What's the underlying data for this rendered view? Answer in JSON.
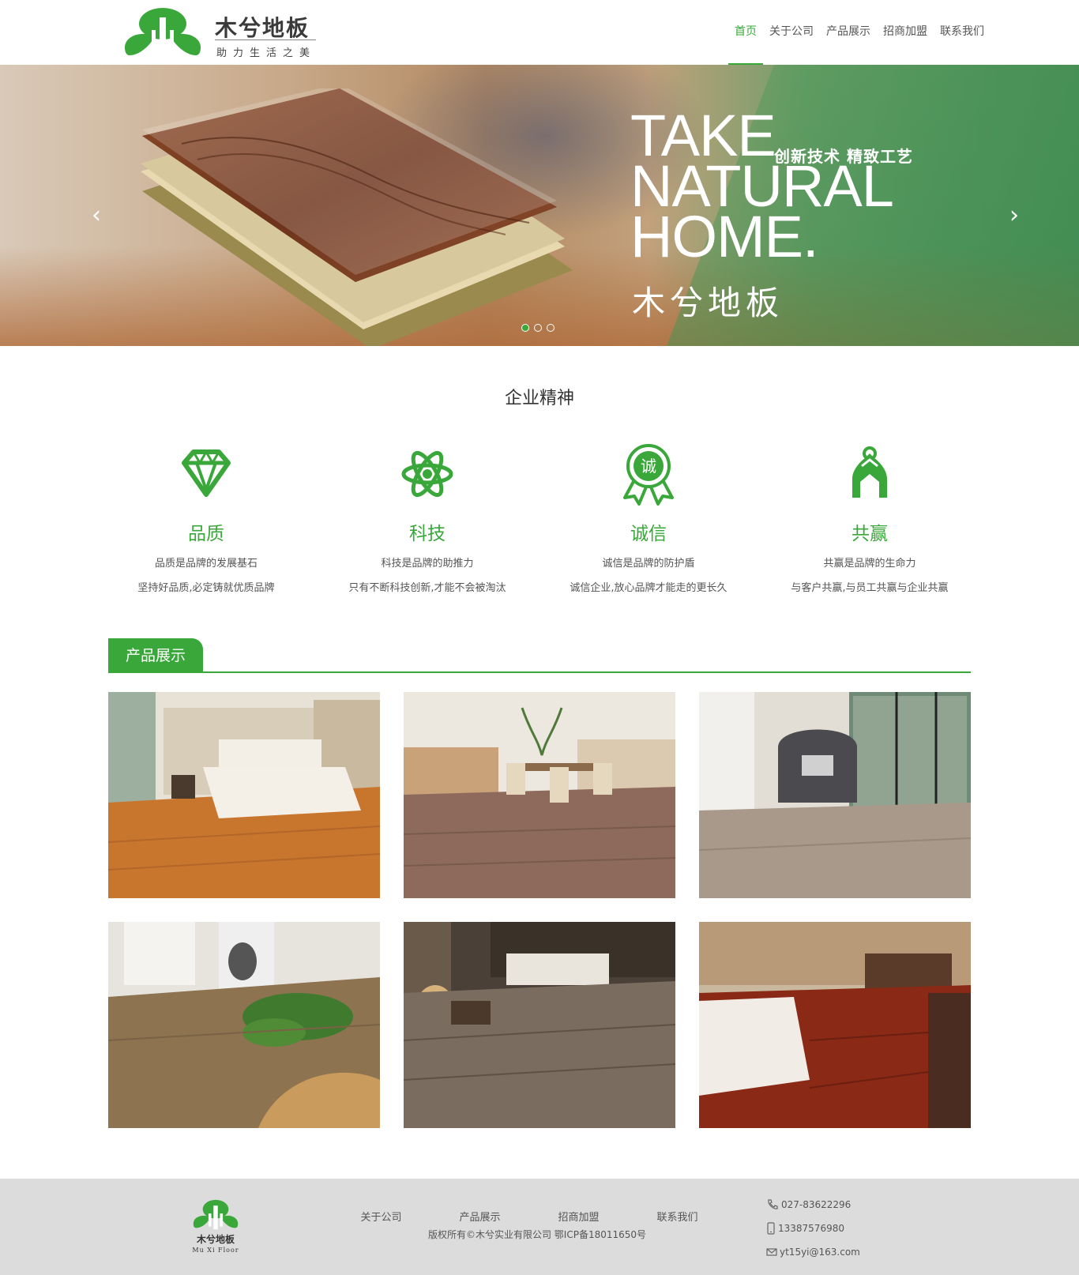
{
  "brand": {
    "name": "木兮地板",
    "tagline": "助力生活之美",
    "footer_name": "木兮地板",
    "footer_en": "Mu Xi Floor"
  },
  "colors": {
    "accent": "#3aa73a",
    "footer_bg": "#dcdcdc"
  },
  "nav": {
    "items": [
      {
        "label": "首页",
        "active": true
      },
      {
        "label": "关于公司"
      },
      {
        "label": "产品展示"
      },
      {
        "label": "招商加盟"
      },
      {
        "label": "联系我们"
      }
    ]
  },
  "banner": {
    "slogan_line1": "TAKE",
    "slogan_line2": "NATURAL",
    "slogan_line3": "HOME.",
    "tag": "创新技术 精致工艺",
    "brand_text": "木兮地板",
    "prev_icon": "chevron-left-icon",
    "next_icon": "chevron-right-icon",
    "slide_count": 3,
    "active_slide": 1
  },
  "spirit": {
    "title": "企业精神",
    "items": [
      {
        "icon": "diamond-icon",
        "name": "品质",
        "line1": "品质是品牌的发展基石",
        "line2": "坚持好品质,必定铸就优质品牌"
      },
      {
        "icon": "atom-icon",
        "name": "科技",
        "line1": "科技是品牌的助推力",
        "line2": "只有不断科技创新,才能不会被淘汰"
      },
      {
        "icon": "medal-icon",
        "name": "诚信",
        "line1": "诚信是品牌的防护盾",
        "line2": "诚信企业,放心品牌才能走的更长久",
        "badge": "诚"
      },
      {
        "icon": "handshake-icon",
        "name": "共赢",
        "line1": "共赢是品牌的生命力",
        "line2": "与客户共赢,与员工共赢与企业共赢"
      }
    ]
  },
  "products": {
    "title": "产品展示",
    "items": [
      {
        "name": "bedroom-orange-floor"
      },
      {
        "name": "dining-grey-floor"
      },
      {
        "name": "armchair-light-floor"
      },
      {
        "name": "plants-oak-floor"
      },
      {
        "name": "living-rustic-floor"
      },
      {
        "name": "bedroom-red-floor"
      }
    ]
  },
  "footer": {
    "links": [
      "关于公司",
      "产品展示",
      "招商加盟",
      "联系我们"
    ],
    "copyright": "版权所有©木兮实业有限公司 鄂ICP备18011650号",
    "phone": "027-83622296",
    "mobile": "13387576980",
    "email": "yt15yi@163.com"
  }
}
